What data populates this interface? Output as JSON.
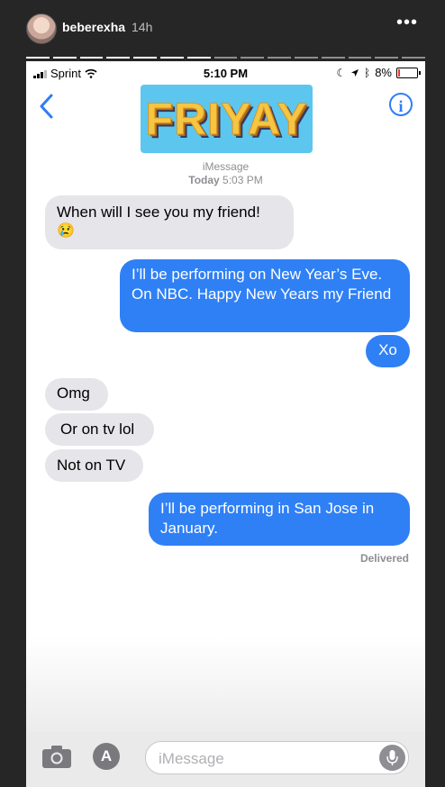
{
  "story": {
    "username": "beberexha",
    "time": "14h",
    "more": "•••"
  },
  "status_bar": {
    "carrier": "Sprint",
    "time": "5:10 PM",
    "battery": "8%"
  },
  "header": {
    "sticker_text": "FRIYAY"
  },
  "conversation": {
    "service": "iMessage",
    "date_prefix": "Today",
    "date_time": "5:03 PM",
    "messages": [
      {
        "dir": "in",
        "text": "When will I see you my friend!"
      },
      {
        "dir": "in",
        "text": "😢"
      },
      {
        "dir": "out",
        "text": "I’ll be performing on New Year’s Eve. On NBC. Happy New Years my Friend"
      },
      {
        "dir": "out",
        "text": "Xo"
      },
      {
        "dir": "in",
        "text": "Omg"
      },
      {
        "dir": "in",
        "text": "Or on tv lol"
      },
      {
        "dir": "in",
        "text": "Not on TV"
      },
      {
        "dir": "out",
        "text": "I’ll be performing in San Jose in January."
      }
    ],
    "delivered": "Delivered"
  },
  "composer": {
    "placeholder": "iMessage"
  }
}
